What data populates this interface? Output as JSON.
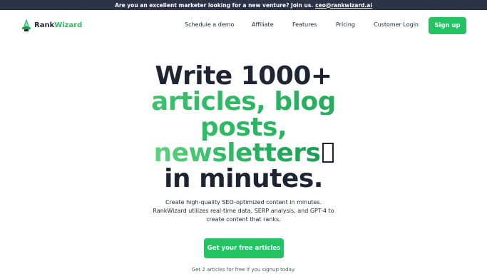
{
  "announcement": {
    "text": "Are you an excellent marketer looking for a new venture? Join us.",
    "email": "ceo@rankwizard.ai"
  },
  "header": {
    "brand_part1": "Rank",
    "brand_part2": "Wizard",
    "logo_icon": "wizard-hat-icon",
    "nav": [
      {
        "label": "Schedule a demo"
      },
      {
        "label": "Affiliate"
      },
      {
        "label": "Features"
      },
      {
        "label": "Pricing"
      },
      {
        "label": "Customer Login"
      }
    ],
    "signup_label": "Sign up"
  },
  "hero": {
    "line1": "Write 1000+",
    "line2": "articles, blog",
    "line3": "posts,",
    "line4": "newsletters",
    "line5": "in minutes."
  },
  "subtitle": {
    "line1": "Create high-quality SEO-optimized content in minutes.",
    "line2": "RankWizard utilizes real-time data, SERP analysis, and GPT-4 to",
    "line3": "create content that ranks."
  },
  "cta_label": "Get your free articles",
  "footnote": "Get 2 articles for free if you signup today.",
  "colors": {
    "accent": "#25c262",
    "brand_green": "#2dbb63",
    "topbar": "#2d3346",
    "text_dark": "#1f2433"
  }
}
